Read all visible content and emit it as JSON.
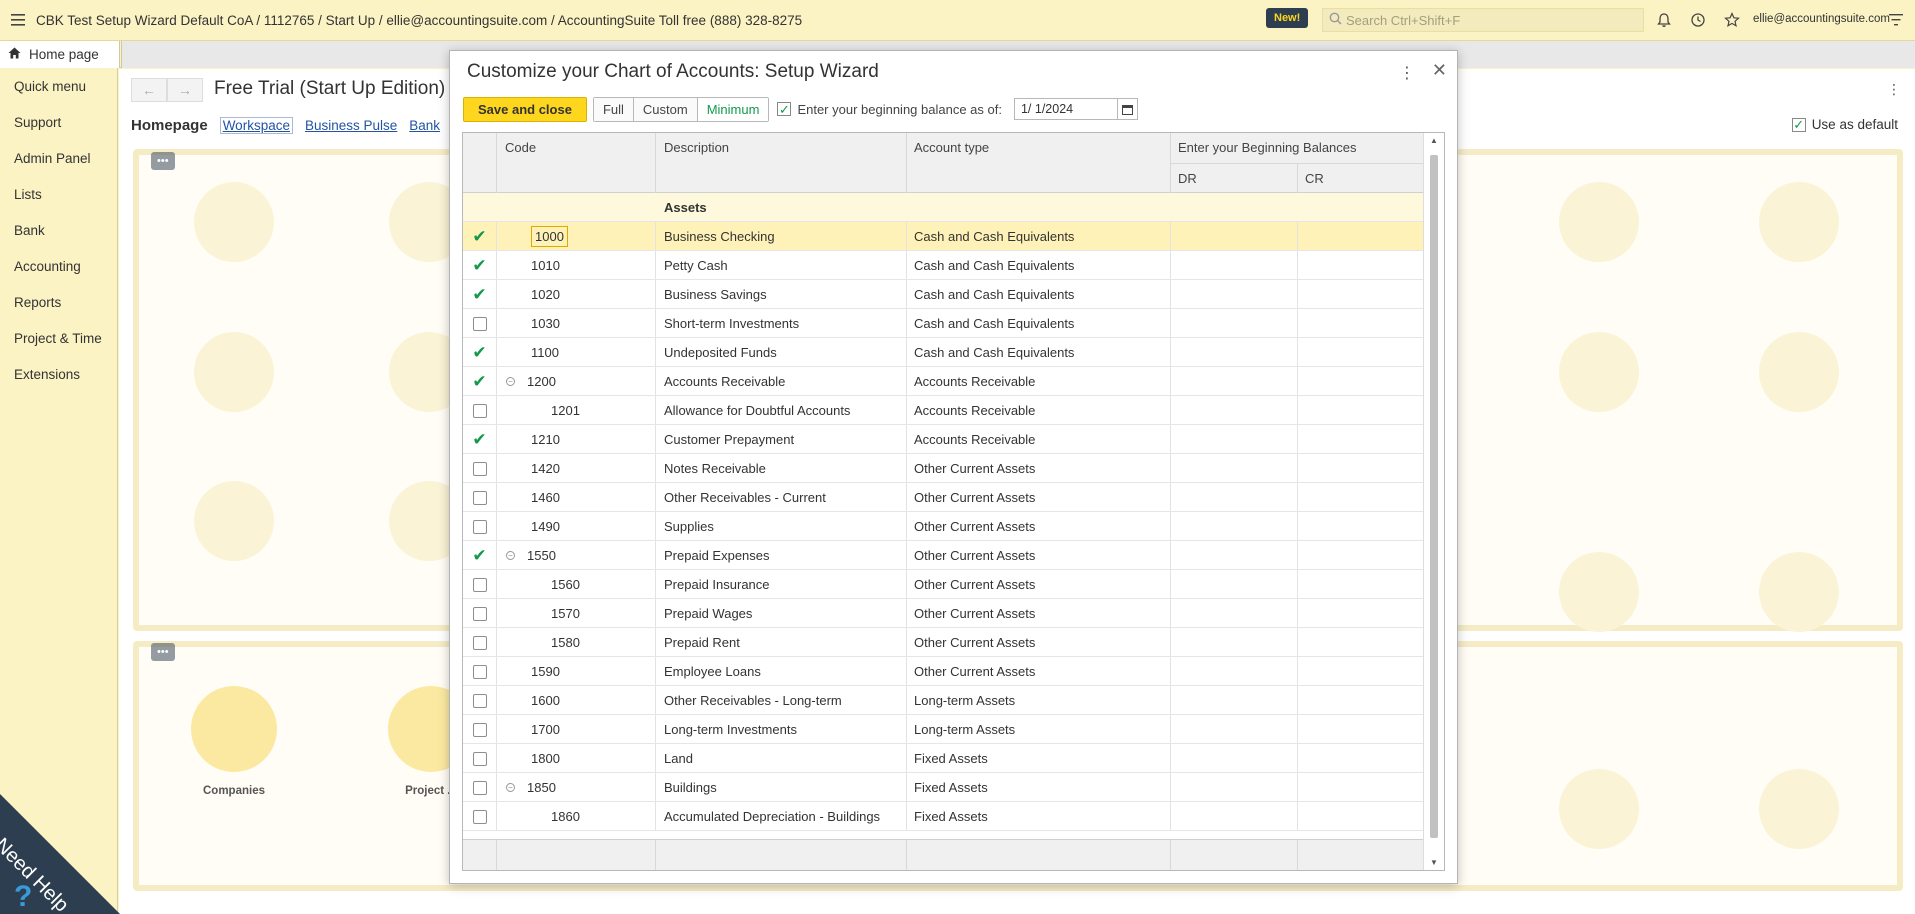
{
  "topbar": {
    "title": "CBK Test Setup Wizard Default CoA / 1112765 / Start Up / ellie@accountingsuite.com / AccountingSuite Toll free (888) 328-8275",
    "new_badge": "New!",
    "search_placeholder": "Search Ctrl+Shift+F",
    "user_email": "ellie@accountingsuite.com"
  },
  "tabs": {
    "home": "Home page"
  },
  "sidebar": {
    "items": [
      {
        "label": "Quick menu"
      },
      {
        "label": "Support"
      },
      {
        "label": "Admin Panel"
      },
      {
        "label": "Lists"
      },
      {
        "label": "Bank"
      },
      {
        "label": "Accounting"
      },
      {
        "label": "Reports"
      },
      {
        "label": "Project & Time"
      },
      {
        "label": "Extensions"
      }
    ]
  },
  "main": {
    "page_title": "Free Trial (Start Up Edition)",
    "homepage_label": "Homepage",
    "links": [
      "Workspace",
      "Business Pulse",
      "Bank"
    ],
    "use_default": "Use as default",
    "background_tiles": [
      "Companies",
      "Project ..."
    ]
  },
  "need_help": "Need Help",
  "dialog": {
    "title": "Customize your Chart of Accounts: Setup Wizard",
    "save_label": "Save and close",
    "modes": [
      "Full",
      "Custom",
      "Minimum"
    ],
    "active_mode": "Minimum",
    "begin_balance_label": "Enter your beginning balance as of:",
    "begin_date": "1/ 1/2024",
    "columns": {
      "code": "Code",
      "description": "Description",
      "account_type": "Account type",
      "balances": "Enter your Beginning Balances",
      "dr": "DR",
      "cr": "CR"
    },
    "group": "Assets",
    "rows": [
      {
        "checked": true,
        "code": "1000",
        "description": "Business Checking",
        "type": "Cash and Cash Equivalents",
        "level": 0,
        "collapsible": false,
        "selected": true
      },
      {
        "checked": true,
        "code": "1010",
        "description": "Petty Cash",
        "type": "Cash and Cash Equivalents",
        "level": 0,
        "collapsible": false
      },
      {
        "checked": true,
        "code": "1020",
        "description": "Business Savings",
        "type": "Cash and Cash Equivalents",
        "level": 0,
        "collapsible": false
      },
      {
        "checked": false,
        "code": "1030",
        "description": "Short-term Investments",
        "type": "Cash and Cash Equivalents",
        "level": 0,
        "collapsible": false
      },
      {
        "checked": true,
        "code": "1100",
        "description": "Undeposited Funds",
        "type": "Cash and Cash Equivalents",
        "level": 0,
        "collapsible": false
      },
      {
        "checked": true,
        "code": "1200",
        "description": "Accounts Receivable",
        "type": "Accounts Receivable",
        "level": 0,
        "collapsible": true
      },
      {
        "checked": false,
        "code": "1201",
        "description": "Allowance for Doubtful Accounts",
        "type": "Accounts Receivable",
        "level": 1,
        "collapsible": false
      },
      {
        "checked": true,
        "code": "1210",
        "description": "Customer Prepayment",
        "type": "Accounts Receivable",
        "level": 0,
        "collapsible": false
      },
      {
        "checked": false,
        "code": "1420",
        "description": "Notes Receivable",
        "type": "Other Current Assets",
        "level": 0,
        "collapsible": false
      },
      {
        "checked": false,
        "code": "1460",
        "description": "Other Receivables - Current",
        "type": "Other Current Assets",
        "level": 0,
        "collapsible": false
      },
      {
        "checked": false,
        "code": "1490",
        "description": "Supplies",
        "type": "Other Current Assets",
        "level": 0,
        "collapsible": false
      },
      {
        "checked": true,
        "code": "1550",
        "description": "Prepaid Expenses",
        "type": "Other Current Assets",
        "level": 0,
        "collapsible": true
      },
      {
        "checked": false,
        "code": "1560",
        "description": "Prepaid Insurance",
        "type": "Other Current Assets",
        "level": 1,
        "collapsible": false
      },
      {
        "checked": false,
        "code": "1570",
        "description": "Prepaid Wages",
        "type": "Other Current Assets",
        "level": 1,
        "collapsible": false
      },
      {
        "checked": false,
        "code": "1580",
        "description": "Prepaid Rent",
        "type": "Other Current Assets",
        "level": 1,
        "collapsible": false
      },
      {
        "checked": false,
        "code": "1590",
        "description": "Employee Loans",
        "type": "Other Current Assets",
        "level": 0,
        "collapsible": false
      },
      {
        "checked": false,
        "code": "1600",
        "description": "Other Receivables - Long-term",
        "type": "Long-term Assets",
        "level": 0,
        "collapsible": false
      },
      {
        "checked": false,
        "code": "1700",
        "description": "Long-term Investments",
        "type": "Long-term Assets",
        "level": 0,
        "collapsible": false
      },
      {
        "checked": false,
        "code": "1800",
        "description": "Land",
        "type": "Fixed Assets",
        "level": 0,
        "collapsible": false
      },
      {
        "checked": false,
        "code": "1850",
        "description": "Buildings",
        "type": "Fixed Assets",
        "level": 0,
        "collapsible": true
      },
      {
        "checked": false,
        "code": "1860",
        "description": "Accumulated Depreciation - Buildings",
        "type": "Fixed Assets",
        "level": 1,
        "collapsible": false
      }
    ]
  },
  "colors": {
    "accent": "#ffd61e",
    "check": "#129a4a",
    "app_bg": "#fbf3c4",
    "badge": "#2d3e50"
  }
}
